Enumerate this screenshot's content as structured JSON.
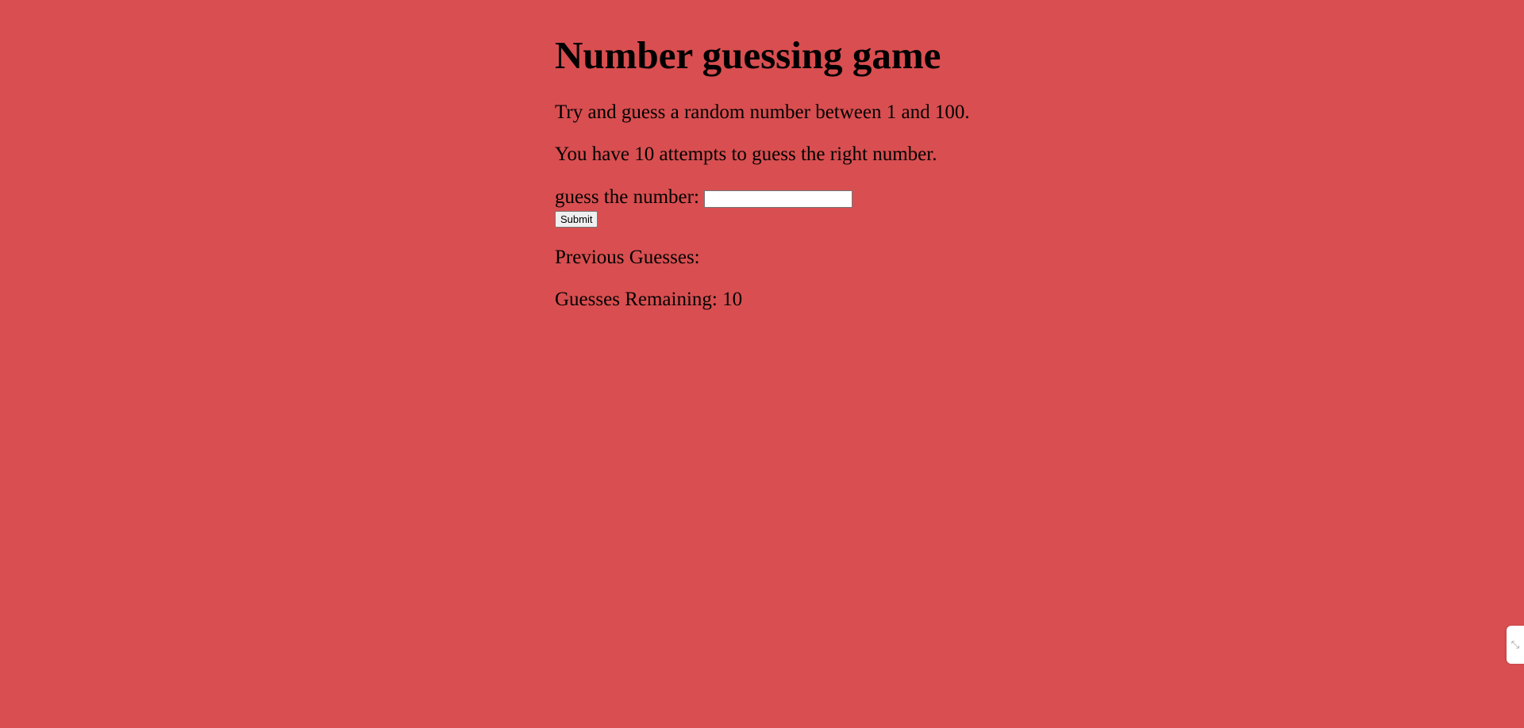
{
  "page": {
    "title": "Number guessing game",
    "intro_line_1": "Try and guess a random number between 1 and 100.",
    "intro_line_2": "You have 10 attempts to guess the right number."
  },
  "form": {
    "guess_label": "guess the number:",
    "guess_value": "",
    "submit_label": "Submit"
  },
  "results": {
    "previous_guesses_label": "Previous Guesses:",
    "guesses_remaining_label": "Guesses Remaining: 10"
  },
  "side_widget": {
    "icon": "collapse-icon",
    "glyph": "⤡"
  },
  "colors": {
    "background": "#d94e50",
    "text": "#000000"
  }
}
